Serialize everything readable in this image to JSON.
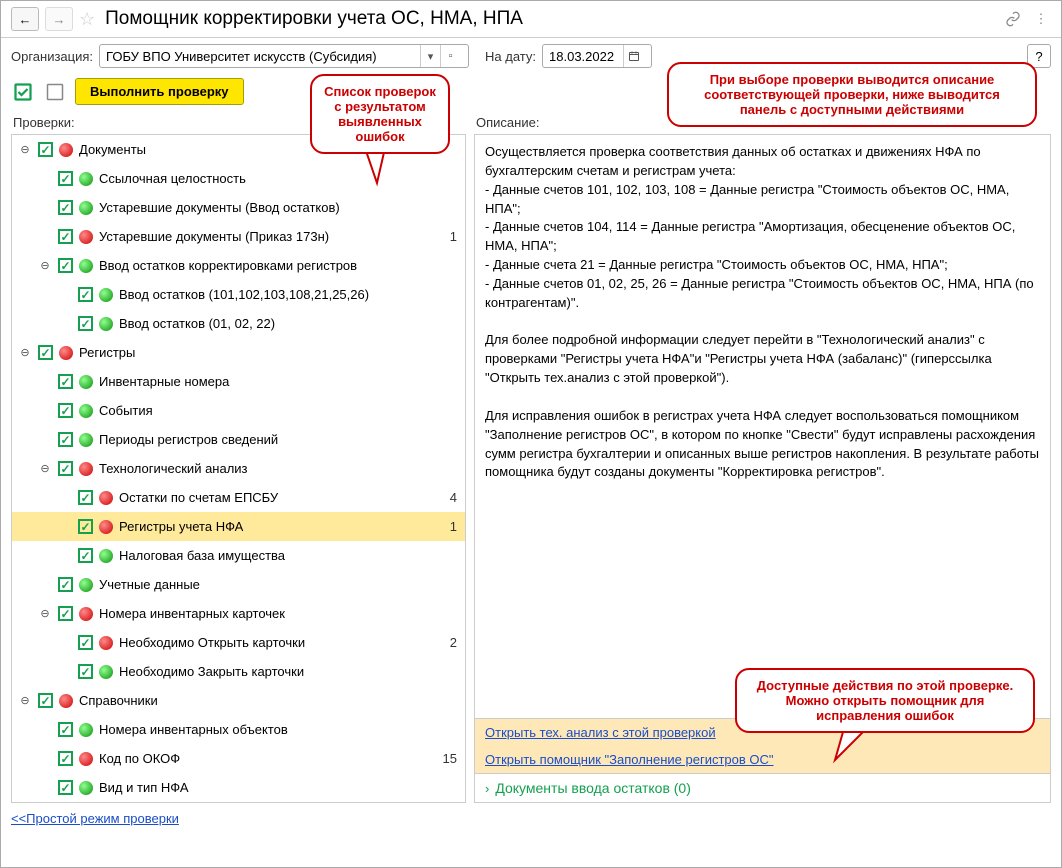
{
  "header": {
    "title": "Помощник корректировки учета ОС, НМА, НПА"
  },
  "toolbar": {
    "org_label": "Организация:",
    "org_value": "ГОБУ ВПО Университет искусств (Субсидия)",
    "date_label": "На дату:",
    "date_value": "18.03.2022",
    "help_label": "?"
  },
  "actions": {
    "run_label": "Выполнить проверку"
  },
  "callouts": {
    "left": "Список проверок с результатом выявленных ошибок",
    "top_right": "При выборе проверки выводится описание соответствующей проверки, ниже выводится панель с доступными действиями",
    "bottom_right": "Доступные действия по этой проверке. Можно открыть помощник для исправления ошибок"
  },
  "left_header": "Проверки:",
  "right_header": "Описание:",
  "tree": [
    {
      "indent": 0,
      "exp": "-",
      "status": "red",
      "label": "Документы",
      "count": ""
    },
    {
      "indent": 1,
      "exp": "",
      "status": "green",
      "label": "Ссылочная целостность",
      "count": ""
    },
    {
      "indent": 1,
      "exp": "",
      "status": "green",
      "label": "Устаревшие документы (Ввод остатков)",
      "count": ""
    },
    {
      "indent": 1,
      "exp": "",
      "status": "red",
      "label": "Устаревшие документы (Приказ 173н)",
      "count": "1"
    },
    {
      "indent": 1,
      "exp": "-",
      "status": "green",
      "label": "Ввод остатков корректировками регистров",
      "count": ""
    },
    {
      "indent": 2,
      "exp": "",
      "status": "green",
      "label": "Ввод остатков (101,102,103,108,21,25,26)",
      "count": ""
    },
    {
      "indent": 2,
      "exp": "",
      "status": "green",
      "label": "Ввод остатков (01, 02, 22)",
      "count": ""
    },
    {
      "indent": 0,
      "exp": "-",
      "status": "red",
      "label": "Регистры",
      "count": ""
    },
    {
      "indent": 1,
      "exp": "",
      "status": "green",
      "label": "Инвентарные номера",
      "count": ""
    },
    {
      "indent": 1,
      "exp": "",
      "status": "green",
      "label": "События",
      "count": ""
    },
    {
      "indent": 1,
      "exp": "",
      "status": "green",
      "label": "Периоды регистров сведений",
      "count": ""
    },
    {
      "indent": 1,
      "exp": "-",
      "status": "red",
      "label": "Технологический анализ",
      "count": ""
    },
    {
      "indent": 2,
      "exp": "",
      "status": "red",
      "label": "Остатки по счетам ЕПСБУ",
      "count": "4"
    },
    {
      "indent": 2,
      "exp": "",
      "status": "red",
      "label": "Регистры учета НФА",
      "count": "1",
      "sel": true
    },
    {
      "indent": 2,
      "exp": "",
      "status": "green",
      "label": "Налоговая база имущества",
      "count": ""
    },
    {
      "indent": 1,
      "exp": "",
      "status": "green",
      "label": "Учетные данные",
      "count": ""
    },
    {
      "indent": 1,
      "exp": "-",
      "status": "red",
      "label": "Номера инвентарных карточек",
      "count": ""
    },
    {
      "indent": 2,
      "exp": "",
      "status": "red",
      "label": "Необходимо Открыть карточки",
      "count": "2"
    },
    {
      "indent": 2,
      "exp": "",
      "status": "green",
      "label": "Необходимо Закрыть карточки",
      "count": ""
    },
    {
      "indent": 0,
      "exp": "-",
      "status": "red",
      "label": "Справочники",
      "count": ""
    },
    {
      "indent": 1,
      "exp": "",
      "status": "green",
      "label": "Номера инвентарных объектов",
      "count": ""
    },
    {
      "indent": 1,
      "exp": "",
      "status": "red",
      "label": "Код по ОКОФ",
      "count": "15"
    },
    {
      "indent": 1,
      "exp": "",
      "status": "green",
      "label": "Вид и тип НФА",
      "count": ""
    }
  ],
  "description": {
    "p1": "Осуществляется проверка соответствия данных об остатках и движениях НФА по бухгалтерским счетам и регистрам учета:",
    "b1": "   - Данные счетов 101, 102, 103, 108 = Данные регистра \"Стоимость объектов ОС, НМА, НПА\";",
    "b2": "   - Данные счетов 104, 114 = Данные регистра \"Амортизация, обесценение объектов ОС, НМА, НПА\";",
    "b3": "   - Данные счета 21 = Данные регистра \"Стоимость объектов ОС, НМА, НПА\";",
    "b4": "   - Данные счетов 01, 02, 25, 26 = Данные регистра \"Стоимость объектов ОС, НМА, НПА (по контрагентам)\".",
    "p2": "Для более подробной информации следует перейти в \"Технологический анализ\" с проверками \"Регистры учета НФА\"и \"Регистры учета НФА (забаланс)\" (гиперссылка \"Открыть тех.анализ с этой проверкой\").",
    "p3": "Для исправления ошибок в регистрах учета НФА следует воспользоваться помощником \"Заполнение регистров ОС\", в котором по кнопке \"Свести\" будут исправлены расхождения сумм регистра бухгалтерии и описанных выше регистров накопления. В результате работы помощника будут созданы документы \"Корректировка регистров\"."
  },
  "links": {
    "l1": "Открыть тех. анализ с этой проверкой",
    "l2": "Открыть помощник \"Заполнение регистров ОС\""
  },
  "docs_row": "Документы ввода остатков (0)",
  "bottom_link": "<<Простой режим проверки"
}
